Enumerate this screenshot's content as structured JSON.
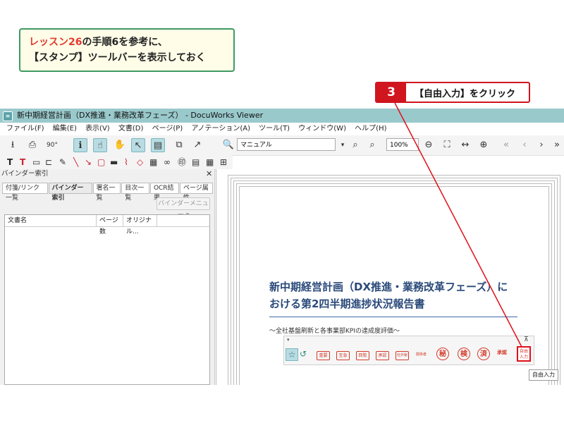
{
  "note": {
    "line1_highlight": "レッスン26",
    "line1_rest": "の手順6を参考に、",
    "line2": "【スタンプ】ツールバーを表示しておく"
  },
  "callout": {
    "step": "3",
    "text": "【自由入力】をクリック"
  },
  "window": {
    "title": "新中期経営計画（DX推進・業務改革フェーズ） - DocuWorks Viewer"
  },
  "menubar": [
    "ファイル(F)",
    "編集(E)",
    "表示(V)",
    "文書(D)",
    "ページ(P)",
    "アノテーション(A)",
    "ツール(T)",
    "ウィンドウ(W)",
    "ヘルプ(H)"
  ],
  "toolbar": {
    "rotate_label": "90°",
    "search_value": "マニュアル",
    "zoom_value": "100%"
  },
  "pane": {
    "title": "バインダー索引",
    "tabs": [
      "付箋/リンク一覧",
      "バインダー索引",
      "署名一覧",
      "目次一覧",
      "OCR結果",
      "ページ属性"
    ],
    "menu_button": "バインダーメニュー",
    "columns": [
      "文書名",
      "ページ数",
      "オリジナル..."
    ]
  },
  "document": {
    "title_line1": "新中期経営計画（DX推進・業務改革フェーズ）に",
    "title_line2": "おける第2四半期進捗状況報告書",
    "subtitle": "～全社基盤刷新と各事業部KPIの達成度評価～"
  },
  "stampbar": {
    "stamps": [
      "重要",
      "至急",
      "回覧",
      "承認",
      "社外秘",
      "関係者"
    ],
    "round_stamps": [
      "秘",
      "検",
      "済"
    ],
    "approved": "承認",
    "free_input": "自由入力",
    "tooltip": "自由入力"
  },
  "colors": {
    "accent": "#d0151f",
    "note_border": "#3e9a63",
    "titlebar": "#9ac9cc",
    "doc_title": "#2a4a7a"
  }
}
